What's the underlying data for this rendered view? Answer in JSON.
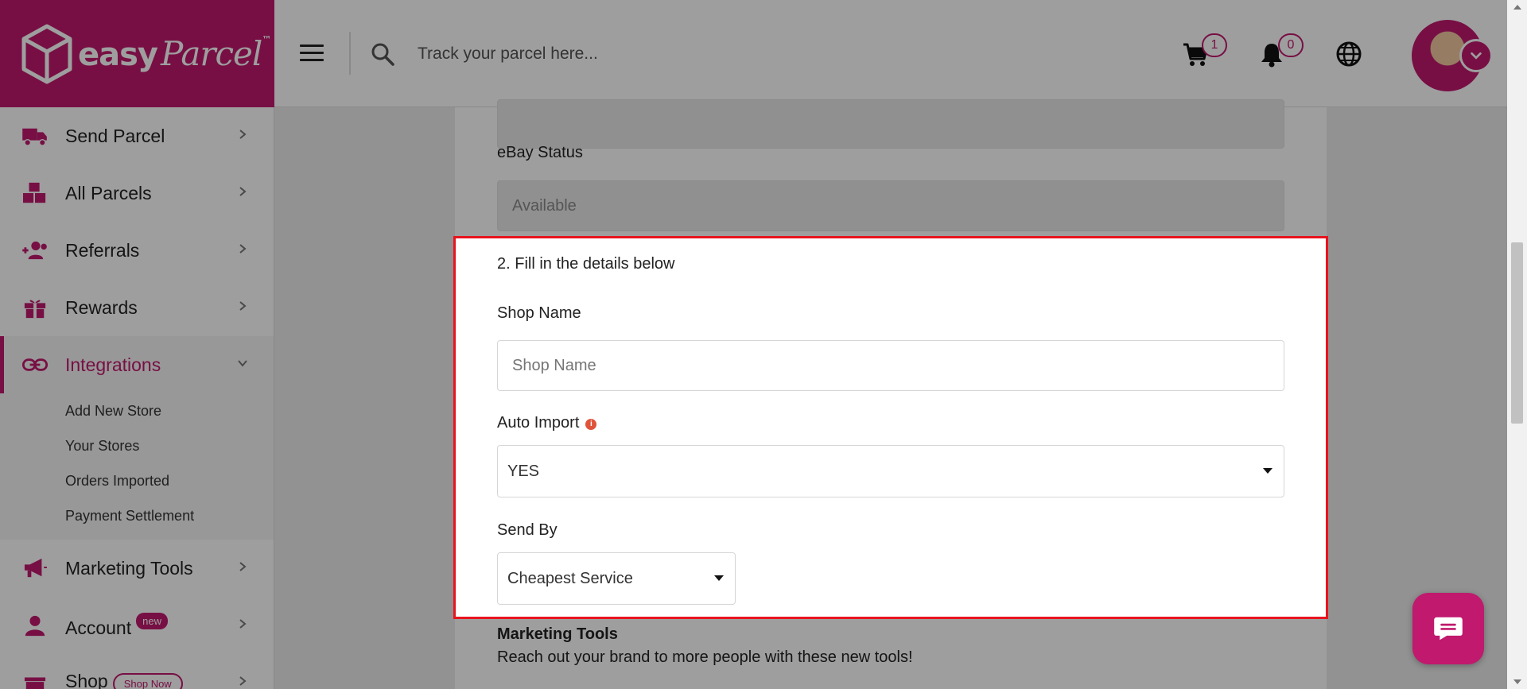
{
  "brand": {
    "logo_main": "easy",
    "logo_script": "Parcel",
    "logo_tm": "™",
    "color": "#c0196e"
  },
  "header": {
    "search_placeholder": "Track your parcel here...",
    "cart_count": "1",
    "notification_count": "0",
    "icons": [
      "menu-icon",
      "search-icon",
      "cart-icon",
      "bell-icon",
      "globe-icon",
      "avatar",
      "chevron-down-icon"
    ]
  },
  "sidebar": {
    "items": [
      {
        "label": "Send Parcel",
        "icon": "truck-icon"
      },
      {
        "label": "All Parcels",
        "icon": "boxes-icon"
      },
      {
        "label": "Referrals",
        "icon": "user-plus-icon"
      },
      {
        "label": "Rewards",
        "icon": "gift-icon"
      },
      {
        "label": "Integrations",
        "icon": "link-icon"
      },
      {
        "label": "Marketing Tools",
        "icon": "megaphone-icon"
      },
      {
        "label": "Account",
        "icon": "user-icon",
        "badge": "new"
      },
      {
        "label": "Shop",
        "icon": "shop-icon",
        "badge": "Shop Now"
      }
    ],
    "sub_items": [
      "Add New Store",
      "Your Stores",
      "Orders Imported",
      "Payment Settlement"
    ]
  },
  "form": {
    "ebay_status_label": "eBay Status",
    "ebay_status_value": "Available",
    "step_title": "2. Fill in the details below",
    "shop_name_label": "Shop Name",
    "shop_name_placeholder": "Shop Name",
    "auto_import_label": "Auto Import",
    "auto_import_value": "YES",
    "send_by_label": "Send By",
    "send_by_value": "Cheapest Service"
  },
  "marketing": {
    "title": "Marketing Tools",
    "text": "Reach out your brand to more people with these new tools!"
  },
  "colors": {
    "highlight": "#e8141e",
    "accent": "#c0196e"
  }
}
